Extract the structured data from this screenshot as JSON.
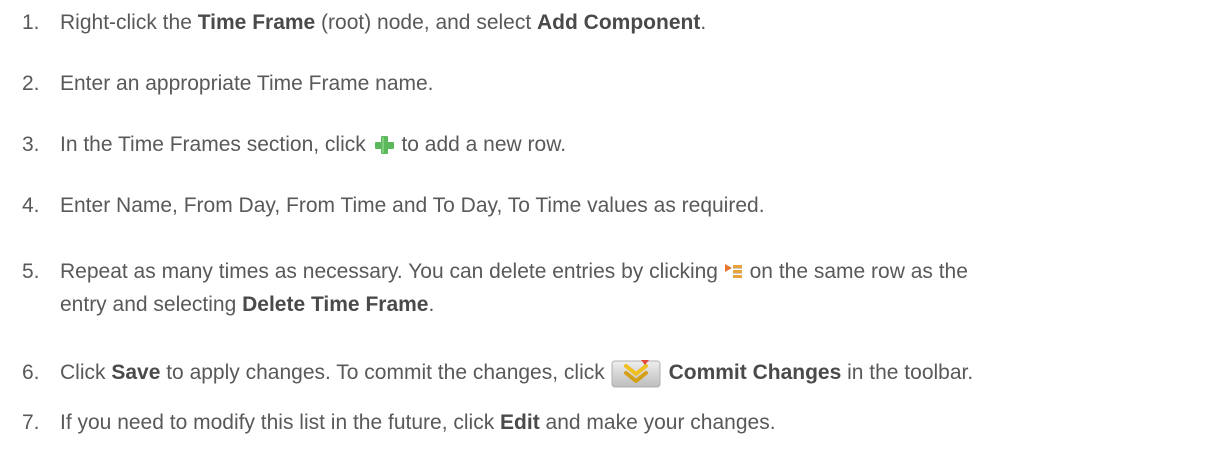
{
  "steps": [
    {
      "number": "1.",
      "before": "Right-click the ",
      "bold1": "Time Frame",
      "middle": " (root) node, and select ",
      "bold2": "Add Component",
      "after": "."
    },
    {
      "number": "2.",
      "text": "Enter an appropriate Time Frame name."
    },
    {
      "number": "3.",
      "before": "In the Time Frames section, click ",
      "icon": "green-plus-icon",
      "after": " to add a new row."
    },
    {
      "number": "4.",
      "text": "Enter Name, From Day, From Time and To Day, To Time values as required."
    },
    {
      "number": "5.",
      "before": "Repeat as many times as necessary. You can delete entries by clicking ",
      "icon": "row-menu-icon",
      "after": " on the same row as the",
      "line2_before": "entry and selecting ",
      "bold": "Delete Time Frame",
      "line2_after": "."
    },
    {
      "number": "6.",
      "before": "Click ",
      "bold1": "Save",
      "middle": " to apply changes. To commit the changes, click ",
      "icon": "commit-changes-icon",
      "bold2": "Commit Changes",
      "after": " in the toolbar."
    },
    {
      "number": "7.",
      "before": "If you need to modify this list in the future, click ",
      "bold": "Edit",
      "after": " and make your changes."
    }
  ],
  "colors": {
    "text": "#595959",
    "bold_text": "#4a4a4a",
    "plus_icon": "#5cb85c",
    "row_menu_icon_accent": "#e8762c",
    "commit_icon_accent": "#f0c020"
  }
}
